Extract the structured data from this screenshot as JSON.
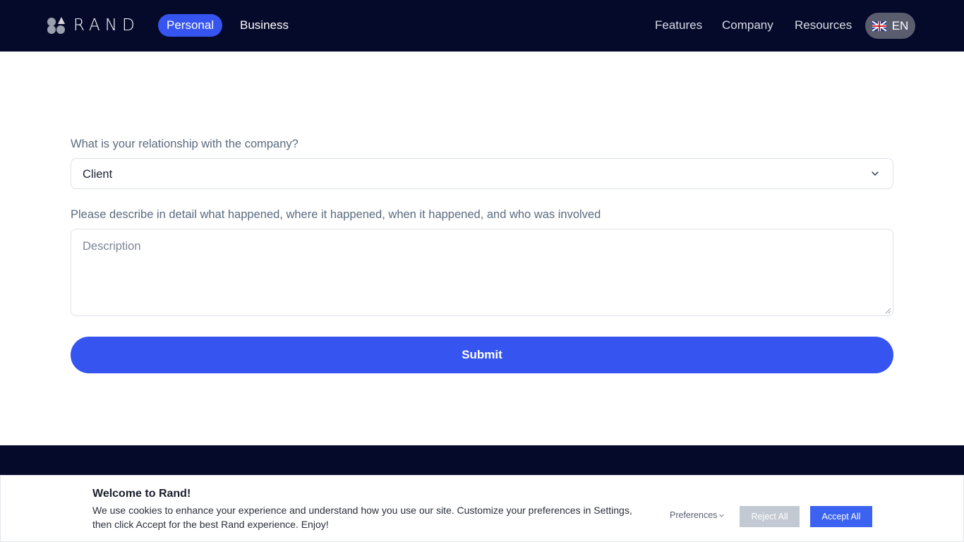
{
  "header": {
    "brand": "RAND",
    "tabs": [
      {
        "label": "Personal",
        "active": true
      },
      {
        "label": "Business",
        "active": false
      }
    ],
    "nav": [
      "Features",
      "Company",
      "Resources"
    ],
    "language": {
      "code": "EN",
      "flag_icon": "uk-flag-icon"
    }
  },
  "form": {
    "relationship_label": "What is your relationship with the company?",
    "relationship_value": "Client",
    "description_label": "Please describe in detail what happened, where it happened, when it happened, and who was involved",
    "description_placeholder": "Description",
    "submit_label": "Submit"
  },
  "cookie_banner": {
    "title": "Welcome to Rand!",
    "body": "We use cookies to enhance your experience and understand how you use our site. Customize your preferences in Settings, then click Accept for the best Rand experience. Enjoy!",
    "preferences_label": "Preferences",
    "reject_label": "Reject All",
    "accept_label": "Accept All"
  },
  "colors": {
    "navbar_bg": "#050a2a",
    "accent": "#3654f0",
    "label_text": "#5b6b80"
  }
}
